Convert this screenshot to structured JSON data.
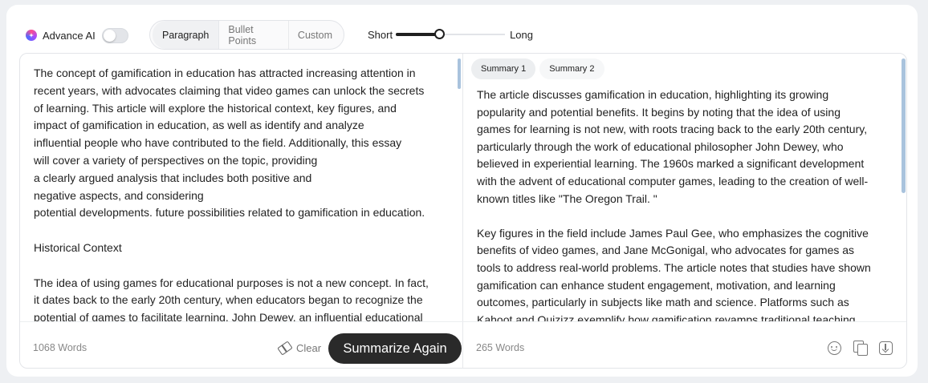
{
  "toolbar": {
    "advance_label": "Advance AI",
    "advance_enabled": false,
    "modes": [
      {
        "label": "Paragraph",
        "active": true
      },
      {
        "label": "Bullet Points",
        "active": false
      },
      {
        "label": "Custom",
        "active": false
      }
    ],
    "length_short_label": "Short",
    "length_long_label": "Long",
    "length_level_fraction": 0.4
  },
  "input": {
    "lines": [
      "The concept of gamification in education has attracted increasing attention in",
      "recent years, with advocates claiming that video games can unlock the secrets",
      "of learning. This article will explore the historical context, key figures, and",
      "impact of gamification in education, as well as identify and analyze",
      "influential people who have contributed to the field. Additionally, this essay",
      "will cover a variety of perspectives on the topic, providing",
      "a clearly argued analysis that includes both positive and",
      "negative aspects, and considering",
      "potential developments. future possibilities related to gamification in education.",
      "",
      "Historical Context",
      "",
      "The idea of using games for educational purposes is not a new concept. In fact,",
      "it dates back to the early 20th century, when educators began to recognize the",
      "potential of games to facilitate learning. John Dewey, an influential educational"
    ],
    "word_count": "1068 Words",
    "clear_label": "Clear",
    "summarize_label": "Summarize Again"
  },
  "output": {
    "tabs": [
      {
        "label": "Summary 1",
        "active": true
      },
      {
        "label": "Summary 2",
        "active": false
      }
    ],
    "lines": [
      "The article discusses gamification in education, highlighting its growing",
      "popularity and potential benefits. It begins by noting that the idea of using",
      "games for learning is not new, with roots tracing back to the early 20th century,",
      "particularly through the work of educational philosopher John Dewey, who",
      "believed in experiential learning. The 1960s marked a significant development",
      "with the advent of educational computer games, leading to the creation of well-",
      "known titles like \"The Oregon Trail. \"",
      "",
      "Key figures in the field include James Paul Gee, who emphasizes the cognitive",
      "benefits of video games, and Jane McGonigal, who advocates for games as",
      "tools to address real-world problems. The article notes that studies have shown",
      "gamification can enhance student engagement, motivation, and learning",
      "outcomes, particularly in subjects like math and science. Platforms such as",
      "Kahoot and Quizizz exemplify how gamification revamps traditional teaching"
    ],
    "word_count": "265 Words",
    "actions": [
      "smile-icon",
      "copy-icon",
      "download-icon"
    ]
  }
}
